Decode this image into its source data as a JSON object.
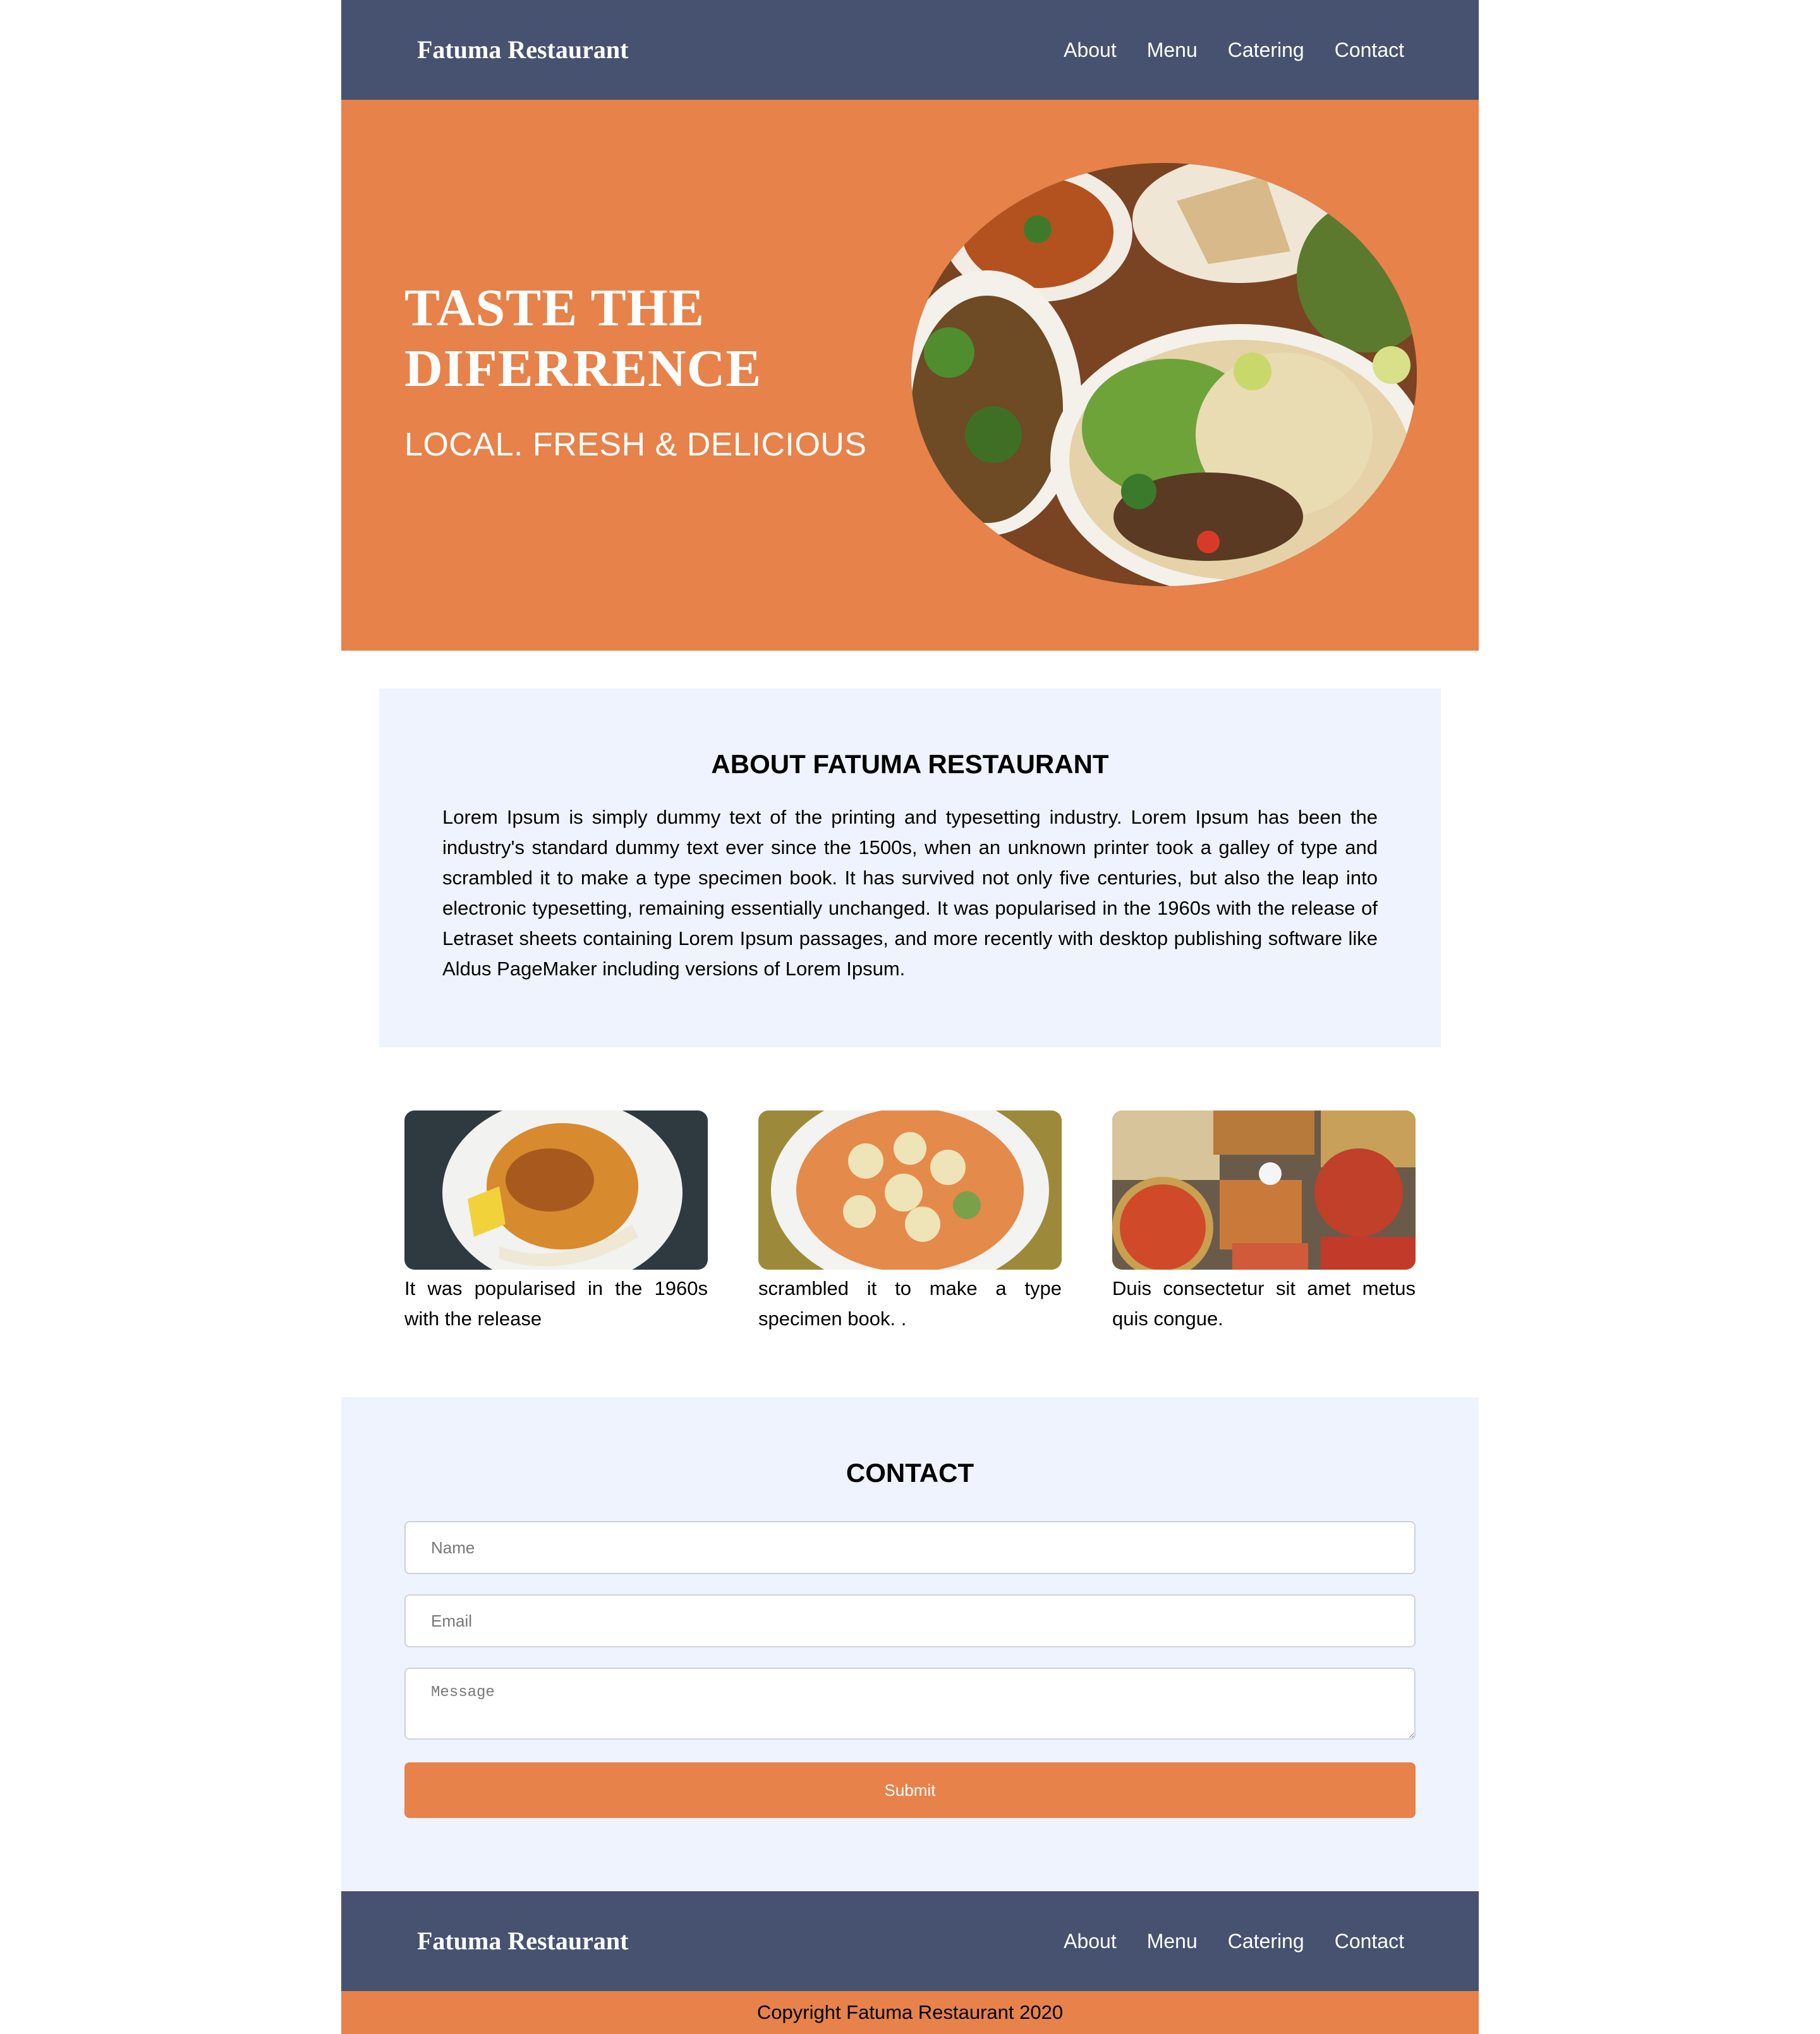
{
  "header": {
    "brand": "Fatuma Restaurant",
    "nav": [
      "About",
      "Menu",
      "Catering",
      "Contact"
    ]
  },
  "hero": {
    "title": "TASTE THE DIFERRENCE",
    "subtitle": "LOCAL. FRESH & DELICIOUS",
    "image_icon": "food-platter-image"
  },
  "about": {
    "title": "ABOUT FATUMA RESTAURANT",
    "text": "Lorem Ipsum is simply dummy text of the printing and typesetting industry. Lorem Ipsum has been the industry's standard dummy text ever since the 1500s, when an unknown printer took a galley of type and scrambled it to make a type specimen book. It has survived not only five centuries, but also the leap into electronic typesetting, remaining essentially unchanged. It was popularised in the 1960s with the release of Letraset sheets containing Lorem Ipsum passages, and more recently with desktop publishing software like Aldus PageMaker including versions of Lorem Ipsum."
  },
  "cards": [
    {
      "caption": "It was popularised in the 1960s with the release",
      "image": "pasta-with-banana-image"
    },
    {
      "caption": "scrambled it to make a type specimen book. .",
      "image": "rice-with-banana-image"
    },
    {
      "caption": "Duis consectetur sit amet metus quis congue.",
      "image": "catering-spread-image"
    }
  ],
  "contact": {
    "title": "CONTACT",
    "name_placeholder": "Name",
    "email_placeholder": "Email",
    "message_placeholder": "Message",
    "submit_label": "Submit"
  },
  "footer": {
    "brand": "Fatuma Restaurant",
    "nav": [
      "About",
      "Menu",
      "Catering",
      "Contact"
    ],
    "copyright": "Copyright Fatuma Restaurant 2020"
  },
  "colors": {
    "navy": "#46526f",
    "orange": "#e6824a",
    "light_blue": "#eef3fd"
  }
}
